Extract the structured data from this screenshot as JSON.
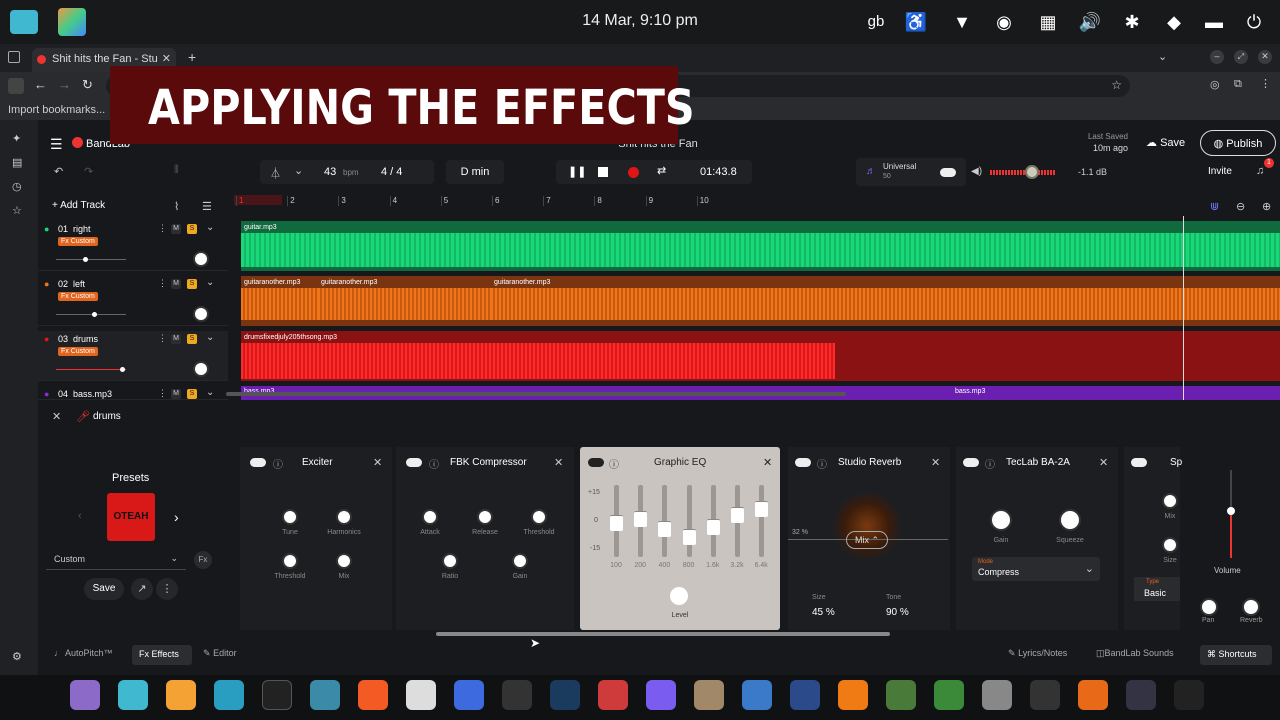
{
  "system": {
    "clock": "14 Mar, 9:10 pm",
    "lang": "gb"
  },
  "browser": {
    "tab_title": "Shit hits the Fan - Stu",
    "bookmarks_label": "Import bookmarks..."
  },
  "banner": {
    "text": "APPLYING THE EFFECTS"
  },
  "header": {
    "brand": "BandLab",
    "song_title": "Shit hits the Fan",
    "last_saved_label": "Last Saved",
    "last_saved_value": "10m ago",
    "save_label": "Save",
    "publish_label": "Publish",
    "invite_label": "Invite",
    "notif_count": "1"
  },
  "transport": {
    "bpm": "43",
    "bpm_unit": "bpm",
    "time_sig": "4 / 4",
    "key": "D min",
    "time": "01:43.8",
    "preset_name": "Universal",
    "preset_value": "50",
    "volume_db": "-1.1 dB"
  },
  "tracks_header": {
    "add_track": "Add Track"
  },
  "ruler": [
    "1",
    "2",
    "3",
    "4",
    "5",
    "6",
    "7",
    "8",
    "9",
    "10"
  ],
  "tracks": [
    {
      "num": "01",
      "name": "right",
      "fx": "Fx Custom",
      "color": "#18d97a"
    },
    {
      "num": "02",
      "name": "left",
      "fx": "Fx Custom",
      "color": "#f07518"
    },
    {
      "num": "03",
      "name": "drums",
      "fx": "Fx Custom",
      "color": "#e01616"
    },
    {
      "num": "04",
      "name": "bass.mp3",
      "fx": "",
      "color": "#8a2bd8"
    }
  ],
  "clips": {
    "c1": "guitar.mp3",
    "c2a": "guitaranother.mp3",
    "c2b": "guitaranother.mp3",
    "c2c": "guitaranother.mp3",
    "c3": "drumsfixedjuly205thsong.mp3",
    "c4a": "bass.mp3",
    "c4b": "bass.mp3"
  },
  "effects_bar": {
    "track_name": "drums",
    "presets_label": "Presets",
    "preset_art": "OTEAH",
    "preset_select": "Custom",
    "save": "Save"
  },
  "effects": {
    "exciter": {
      "title": "Exciter",
      "knobs": [
        "Tune",
        "Harmonics",
        "Threshold",
        "Mix"
      ]
    },
    "compressor": {
      "title": "FBK Compressor",
      "knobs": [
        "Attack",
        "Release",
        "Threshold",
        "Ratio",
        "Gain"
      ]
    },
    "eq": {
      "title": "Graphic EQ",
      "scale": [
        "+15",
        "0",
        "-15"
      ],
      "bands": [
        "100",
        "200",
        "400",
        "800",
        "1.6k",
        "3.2k",
        "6.4k"
      ],
      "level": "Level"
    },
    "reverb": {
      "title": "Studio Reverb",
      "pct": "32 %",
      "mix": "Mix",
      "size_label": "Size",
      "size": "45 %",
      "tone_label": "Tone",
      "tone": "90 %"
    },
    "ba2a": {
      "title": "TecLab BA-2A",
      "knobs": [
        "Gain",
        "Squeeze"
      ],
      "mode_label": "Mode",
      "mode": "Compress"
    },
    "partial": {
      "title": "Sp",
      "mix": "Mix",
      "size": "Size",
      "type_label": "Type",
      "type": "Basic"
    }
  },
  "master": {
    "volume": "Volume",
    "pan": "Pan",
    "reverb": "Reverb"
  },
  "bottom": {
    "autopitch": "AutoPitch™",
    "effects": "Effects",
    "editor": "Editor",
    "lyrics": "Lyrics/Notes",
    "sounds": "BandLab Sounds",
    "shortcuts": "Shortcuts"
  }
}
